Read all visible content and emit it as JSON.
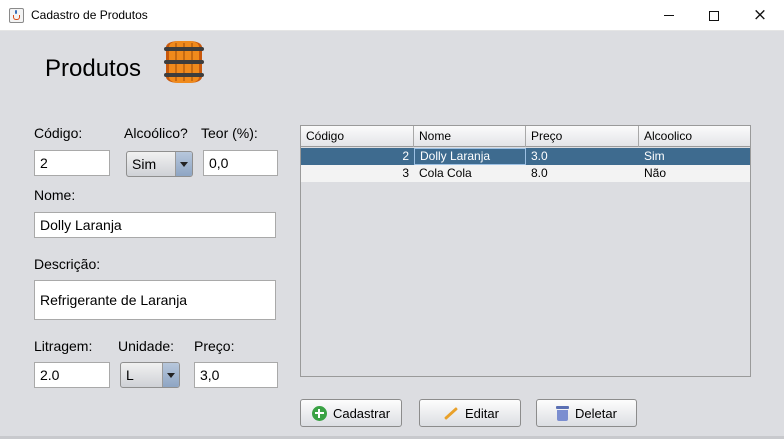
{
  "window": {
    "title": "Cadastro de Produtos",
    "controls": {
      "minimize": "minimize",
      "maximize": "maximize",
      "close": "×"
    }
  },
  "header": {
    "title": "Produtos",
    "icon": "barrel-icon"
  },
  "form": {
    "codigo": {
      "label": "Código:",
      "value": "2"
    },
    "alcoolico": {
      "label": "Alcoólico?",
      "selected": "Sim"
    },
    "teor": {
      "label": "Teor (%):",
      "value": "0,0"
    },
    "nome": {
      "label": "Nome:",
      "value": "Dolly Laranja"
    },
    "descricao": {
      "label": "Descrição:",
      "value": "Refrigerante de Laranja"
    },
    "litragem": {
      "label": "Litragem:",
      "value": "2.0"
    },
    "unidade": {
      "label": "Unidade:",
      "selected": "L"
    },
    "preco": {
      "label": "Preço:",
      "value": "3,0"
    }
  },
  "table": {
    "columns": [
      "Código",
      "Nome",
      "Preço",
      "Alcoolico"
    ],
    "rows": [
      {
        "codigo": "2",
        "nome": "Dolly Laranja",
        "preco": "3.0",
        "alcoolico": "Sim",
        "selected": true
      },
      {
        "codigo": "3",
        "nome": "Cola Cola",
        "preco": "8.0",
        "alcoolico": "Não",
        "selected": false
      }
    ]
  },
  "actions": {
    "cadastrar": {
      "label": "Cadastrar",
      "icon": "add-icon"
    },
    "editar": {
      "label": "Editar",
      "icon": "pencil-icon"
    },
    "deletar": {
      "label": "Deletar",
      "icon": "trash-icon"
    }
  },
  "colors": {
    "selection": "#3e6b8f",
    "background": "#dcdde1"
  }
}
